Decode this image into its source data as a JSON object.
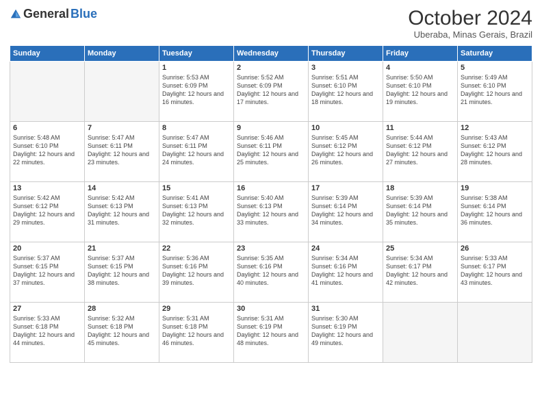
{
  "logo": {
    "general": "General",
    "blue": "Blue"
  },
  "title": "October 2024",
  "location": "Uberaba, Minas Gerais, Brazil",
  "weekdays": [
    "Sunday",
    "Monday",
    "Tuesday",
    "Wednesday",
    "Thursday",
    "Friday",
    "Saturday"
  ],
  "weeks": [
    [
      {
        "day": "",
        "info": ""
      },
      {
        "day": "",
        "info": ""
      },
      {
        "day": "1",
        "info": "Sunrise: 5:53 AM\nSunset: 6:09 PM\nDaylight: 12 hours and 16 minutes."
      },
      {
        "day": "2",
        "info": "Sunrise: 5:52 AM\nSunset: 6:09 PM\nDaylight: 12 hours and 17 minutes."
      },
      {
        "day": "3",
        "info": "Sunrise: 5:51 AM\nSunset: 6:10 PM\nDaylight: 12 hours and 18 minutes."
      },
      {
        "day": "4",
        "info": "Sunrise: 5:50 AM\nSunset: 6:10 PM\nDaylight: 12 hours and 19 minutes."
      },
      {
        "day": "5",
        "info": "Sunrise: 5:49 AM\nSunset: 6:10 PM\nDaylight: 12 hours and 21 minutes."
      }
    ],
    [
      {
        "day": "6",
        "info": "Sunrise: 5:48 AM\nSunset: 6:10 PM\nDaylight: 12 hours and 22 minutes."
      },
      {
        "day": "7",
        "info": "Sunrise: 5:47 AM\nSunset: 6:11 PM\nDaylight: 12 hours and 23 minutes."
      },
      {
        "day": "8",
        "info": "Sunrise: 5:47 AM\nSunset: 6:11 PM\nDaylight: 12 hours and 24 minutes."
      },
      {
        "day": "9",
        "info": "Sunrise: 5:46 AM\nSunset: 6:11 PM\nDaylight: 12 hours and 25 minutes."
      },
      {
        "day": "10",
        "info": "Sunrise: 5:45 AM\nSunset: 6:12 PM\nDaylight: 12 hours and 26 minutes."
      },
      {
        "day": "11",
        "info": "Sunrise: 5:44 AM\nSunset: 6:12 PM\nDaylight: 12 hours and 27 minutes."
      },
      {
        "day": "12",
        "info": "Sunrise: 5:43 AM\nSunset: 6:12 PM\nDaylight: 12 hours and 28 minutes."
      }
    ],
    [
      {
        "day": "13",
        "info": "Sunrise: 5:42 AM\nSunset: 6:12 PM\nDaylight: 12 hours and 29 minutes."
      },
      {
        "day": "14",
        "info": "Sunrise: 5:42 AM\nSunset: 6:13 PM\nDaylight: 12 hours and 31 minutes."
      },
      {
        "day": "15",
        "info": "Sunrise: 5:41 AM\nSunset: 6:13 PM\nDaylight: 12 hours and 32 minutes."
      },
      {
        "day": "16",
        "info": "Sunrise: 5:40 AM\nSunset: 6:13 PM\nDaylight: 12 hours and 33 minutes."
      },
      {
        "day": "17",
        "info": "Sunrise: 5:39 AM\nSunset: 6:14 PM\nDaylight: 12 hours and 34 minutes."
      },
      {
        "day": "18",
        "info": "Sunrise: 5:39 AM\nSunset: 6:14 PM\nDaylight: 12 hours and 35 minutes."
      },
      {
        "day": "19",
        "info": "Sunrise: 5:38 AM\nSunset: 6:14 PM\nDaylight: 12 hours and 36 minutes."
      }
    ],
    [
      {
        "day": "20",
        "info": "Sunrise: 5:37 AM\nSunset: 6:15 PM\nDaylight: 12 hours and 37 minutes."
      },
      {
        "day": "21",
        "info": "Sunrise: 5:37 AM\nSunset: 6:15 PM\nDaylight: 12 hours and 38 minutes."
      },
      {
        "day": "22",
        "info": "Sunrise: 5:36 AM\nSunset: 6:16 PM\nDaylight: 12 hours and 39 minutes."
      },
      {
        "day": "23",
        "info": "Sunrise: 5:35 AM\nSunset: 6:16 PM\nDaylight: 12 hours and 40 minutes."
      },
      {
        "day": "24",
        "info": "Sunrise: 5:34 AM\nSunset: 6:16 PM\nDaylight: 12 hours and 41 minutes."
      },
      {
        "day": "25",
        "info": "Sunrise: 5:34 AM\nSunset: 6:17 PM\nDaylight: 12 hours and 42 minutes."
      },
      {
        "day": "26",
        "info": "Sunrise: 5:33 AM\nSunset: 6:17 PM\nDaylight: 12 hours and 43 minutes."
      }
    ],
    [
      {
        "day": "27",
        "info": "Sunrise: 5:33 AM\nSunset: 6:18 PM\nDaylight: 12 hours and 44 minutes."
      },
      {
        "day": "28",
        "info": "Sunrise: 5:32 AM\nSunset: 6:18 PM\nDaylight: 12 hours and 45 minutes."
      },
      {
        "day": "29",
        "info": "Sunrise: 5:31 AM\nSunset: 6:18 PM\nDaylight: 12 hours and 46 minutes."
      },
      {
        "day": "30",
        "info": "Sunrise: 5:31 AM\nSunset: 6:19 PM\nDaylight: 12 hours and 48 minutes."
      },
      {
        "day": "31",
        "info": "Sunrise: 5:30 AM\nSunset: 6:19 PM\nDaylight: 12 hours and 49 minutes."
      },
      {
        "day": "",
        "info": ""
      },
      {
        "day": "",
        "info": ""
      }
    ]
  ]
}
